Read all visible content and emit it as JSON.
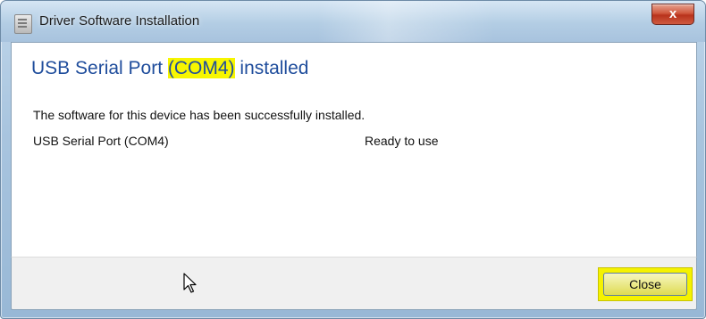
{
  "window": {
    "title": "Driver Software Installation",
    "close_glyph": "x"
  },
  "heading": {
    "prefix": "USB Serial Port ",
    "port": "(COM4)",
    "suffix": " installed"
  },
  "message": "The software for this device has been successfully installed.",
  "devices": [
    {
      "name": "USB Serial Port (COM4)",
      "status": "Ready to use"
    }
  ],
  "footer": {
    "close_label": "Close"
  },
  "colors": {
    "heading": "#1f4d9c",
    "highlight": "#f7f600"
  },
  "icons": {
    "title_icon": "installer-icon",
    "pointer": "mouse-pointer-icon"
  }
}
